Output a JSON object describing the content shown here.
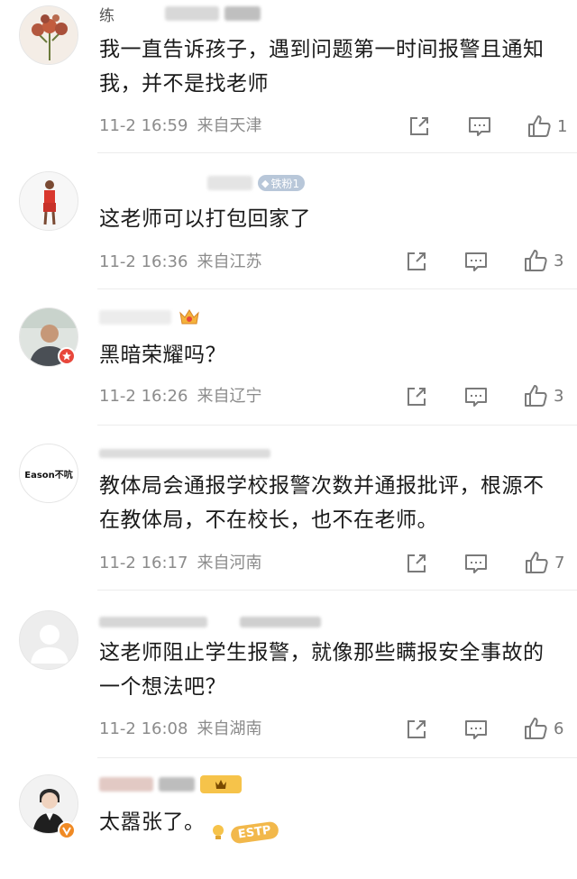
{
  "comments": [
    {
      "username": "练",
      "text": "我一直告诉孩子，遇到问题第一时间报警且通知我，并不是找老师",
      "date": "11-2 16:59",
      "location": "来自天津",
      "likes": "1"
    },
    {
      "username": "",
      "fan_tag": "铁粉1",
      "text": "这老师可以打包回家了",
      "date": "11-2 16:36",
      "location": "来自江苏",
      "likes": "3"
    },
    {
      "username": "",
      "text": "黑暗荣耀吗？",
      "date": "11-2 16:26",
      "location": "来自辽宁",
      "likes": "3"
    },
    {
      "avatar_text": "Eason不吭",
      "username": "",
      "text": "教体局会通报学校报警次数并通报批评，根源不在教体局，不在校长，也不在老师。",
      "date": "11-2 16:17",
      "location": "来自河南",
      "likes": "7"
    },
    {
      "username": "",
      "text": "这老师阻止学生报警，就像那些瞒报安全事故的一个想法吧？",
      "date": "11-2 16:08",
      "location": "来自湖南",
      "likes": "6"
    },
    {
      "username": "",
      "text": "太嚣张了。",
      "sticker_text": "ESTP"
    }
  ],
  "colors": {
    "meta": "#8b8b8b",
    "icon": "#7a7a7a",
    "badge_orange": "#f08a24",
    "badge_red": "#e8473b"
  }
}
